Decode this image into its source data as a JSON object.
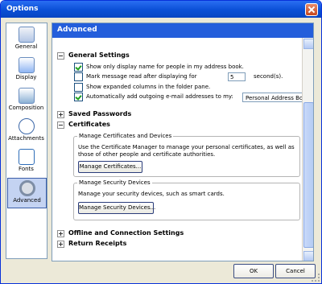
{
  "window": {
    "title": "Options"
  },
  "sidebar": {
    "items": [
      {
        "label": "General",
        "icon": "general-icon"
      },
      {
        "label": "Display",
        "icon": "display-icon"
      },
      {
        "label": "Composition",
        "icon": "composition-icon"
      },
      {
        "label": "Attachments",
        "icon": "paperclip-icon"
      },
      {
        "label": "Fonts",
        "icon": "fonts-icon"
      },
      {
        "label": "Advanced",
        "icon": "gear-icon",
        "selected": true
      }
    ]
  },
  "panel": {
    "title": "Advanced",
    "sections": {
      "general_settings": "General Settings",
      "saved_passwords": "Saved Passwords",
      "certificates": "Certificates",
      "offline": "Offline and Connection Settings",
      "receipts": "Return Receipts"
    },
    "general": {
      "show_display_name": {
        "label": "Show only display name for people in my address book.",
        "checked": true
      },
      "mark_read": {
        "label": "Mark message read after displaying for",
        "checked": false,
        "value": "5",
        "suffix": "second(s)."
      },
      "expanded_columns": {
        "label": "Show expanded columns in the folder pane.",
        "checked": false
      },
      "auto_add": {
        "label": "Automatically add outgoing e-mail addresses to my:",
        "checked": true,
        "selected": "Personal Address Book"
      }
    },
    "certificates": {
      "manage_group": {
        "legend": "Manage Certificates and Devices",
        "text": "Use the Certificate Manager to manage your personal certificates, as well as those of other people and certificate authorities.",
        "button": "Manage Certificates..."
      },
      "security_group": {
        "legend": "Manage Security Devices",
        "text": "Manage your security devices, such as smart cards.",
        "button": "Manage Security Devices..."
      }
    }
  },
  "footer": {
    "ok": "OK",
    "cancel": "Cancel"
  }
}
